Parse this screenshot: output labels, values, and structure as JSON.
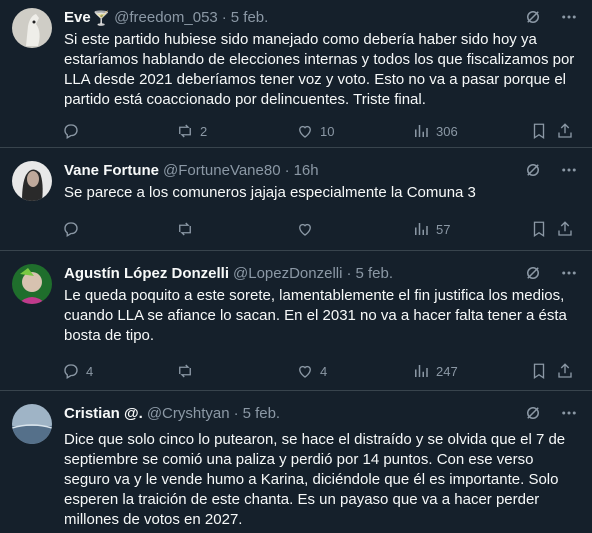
{
  "tweets": [
    {
      "name": "Eve",
      "name_emoji": "🍸",
      "handle": "@freedom_053",
      "time": "5 feb.",
      "text": "Si este partido hubiese sido manejado como debería haber sido hoy ya estaríamos hablando de elecciones internas y todos los que fiscalizamos por LLA desde 2021 deberíamos tener voz y voto. Esto no va a pasar porque el partido está coaccionado por delincuentes. Triste final.",
      "replies": "",
      "retweets": "2",
      "likes": "10",
      "views": "306",
      "avatar_color": "#d8d6cf"
    },
    {
      "name": "Vane Fortune",
      "name_emoji": "",
      "handle": "@FortuneVane80",
      "time": "16h",
      "text": "Se parece a los comuneros jajaja especialmente la Comuna 3",
      "replies": "",
      "retweets": "",
      "likes": "",
      "views": "57",
      "avatar_color": "#6a6a6a"
    },
    {
      "name": "Agustín López Donzelli",
      "name_emoji": "",
      "handle": "@LopezDonzelli",
      "time": "5 feb.",
      "text": "Le queda poquito a este sorete, lamentablemente el fin justifica los medios, cuando LLA se afiance lo sacan. En el 2031 no va a hacer falta tener a ésta bosta de tipo.",
      "replies": "4",
      "retweets": "",
      "likes": "4",
      "views": "247",
      "avatar_color": "#2f8a3a"
    },
    {
      "name": "Cristian @.",
      "name_emoji": "",
      "handle": "@Cryshtyan",
      "time": "5 feb.",
      "text": "Dice que solo cinco lo putearon, se hace el distraído y se olvida que el 7 de septiembre se comió una paliza y perdió por 14 puntos. Con ese verso seguro va y le vende humo a Karina, diciéndole que él es importante. Solo esperen la traición de este chanta. Es un payaso que va a hacer perder millones de votos en 2027.",
      "replies": "",
      "retweets": "",
      "likes": "",
      "views": "",
      "avatar_color": "#7a95ad"
    }
  ],
  "colors": {
    "background": "#15202b",
    "text": "#f7f9f9",
    "muted": "#8b98a5",
    "divider": "#38444d"
  }
}
